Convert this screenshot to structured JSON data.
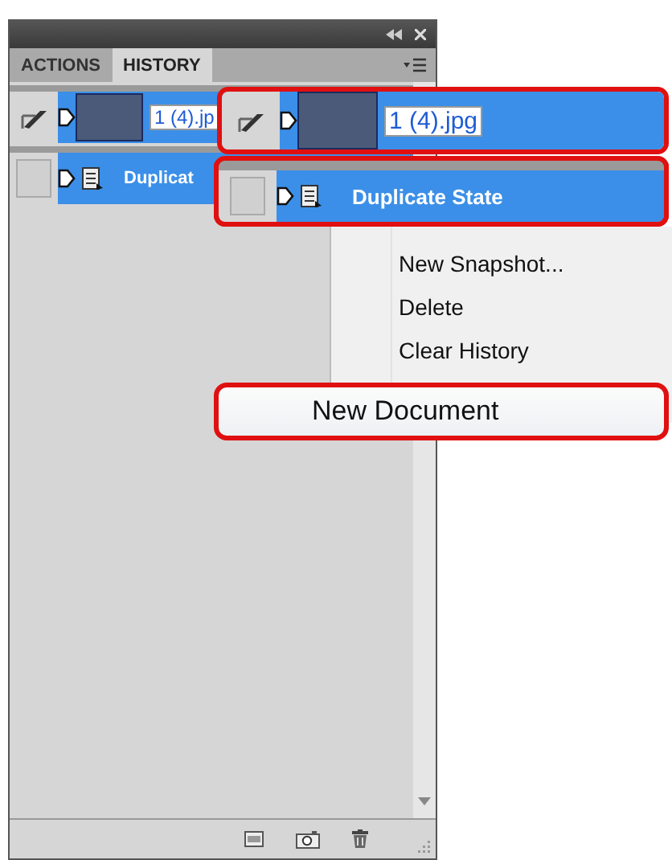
{
  "panel": {
    "tabs": [
      {
        "label": "ACTIONS",
        "selected": false
      },
      {
        "label": "HISTORY",
        "selected": true
      }
    ],
    "history": [
      {
        "kind": "snapshot",
        "label": "1 (4).jp",
        "selected": true
      },
      {
        "kind": "state",
        "label": "Duplicat",
        "selected": true
      }
    ]
  },
  "callouts": [
    {
      "kind": "snapshot",
      "label": "1 (4).jpg"
    },
    {
      "kind": "state",
      "label": "Duplicate State"
    }
  ],
  "context_menu": {
    "items": [
      {
        "label": "New Snapshot...",
        "highlighted": false
      },
      {
        "label": "Delete",
        "highlighted": false
      },
      {
        "label": "Clear History",
        "highlighted": false
      },
      {
        "label": "New Document",
        "highlighted": true
      }
    ]
  }
}
